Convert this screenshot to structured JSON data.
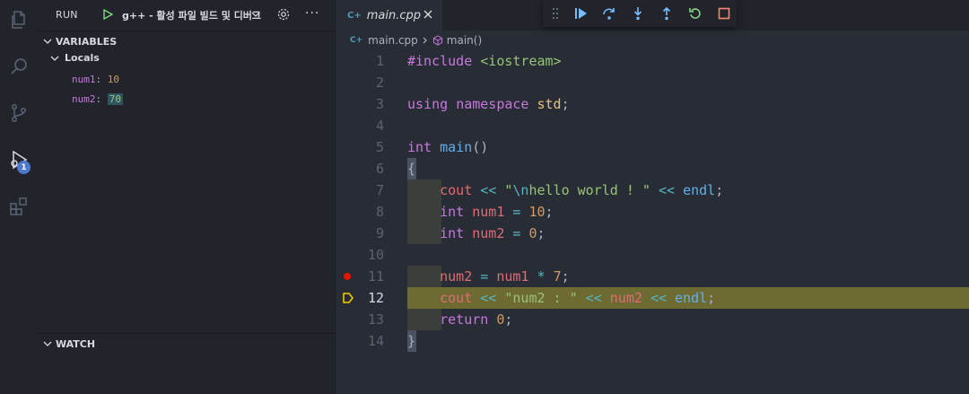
{
  "sidebar": {
    "title": "RUN",
    "config": "g++ - 활성 파일 빌드 및 디버그",
    "more": "···",
    "variables_title": "VARIABLES",
    "locals_title": "Locals",
    "vars": [
      {
        "name": "num1",
        "value": "10"
      },
      {
        "name": "num2",
        "value": "70"
      }
    ],
    "watch_title": "WATCH"
  },
  "activity": {
    "debug_badge": "1"
  },
  "tab": {
    "icon": "C+",
    "name": "main.cpp"
  },
  "breadcrumb": {
    "icon": "C+",
    "file": "main.cpp",
    "symbol": "main()"
  },
  "code": {
    "line_numbers": [
      "1",
      "2",
      "3",
      "4",
      "5",
      "6",
      "7",
      "8",
      "9",
      "10",
      "11",
      "12",
      "13",
      "14"
    ],
    "l1": {
      "directive": "#include",
      "header": "<iostream>"
    },
    "l3": {
      "using": "using",
      "namespace": "namespace",
      "std": "std",
      "semi": ";"
    },
    "l5": {
      "type": "int",
      "func": "main",
      "parens": "()"
    },
    "l6": {
      "brace": "{"
    },
    "l7": {
      "cout": "cout",
      "op1": "<<",
      "str1": "\"",
      "esc": "\\n",
      "str2": "hello world ! \"",
      "op2": "<<",
      "endl": "endl",
      "semi": ";"
    },
    "l8": {
      "type": "int",
      "var": "num1",
      "eq": "=",
      "num": "10",
      "semi": ";"
    },
    "l9": {
      "type": "int",
      "var": "num2",
      "eq": "=",
      "num": "0",
      "semi": ";"
    },
    "l11": {
      "var": "num2",
      "eq": "=",
      "var2": "num1",
      "mul": "*",
      "num": "7",
      "semi": ";"
    },
    "l12": {
      "cout": "cout",
      "op1": "<<",
      "str": "\"num2 : \"",
      "op2": "<<",
      "var": "num2",
      "op3": "<<",
      "endl": "endl",
      "semi": ";"
    },
    "l13": {
      "ret": "return",
      "num": "0",
      "semi": ";"
    },
    "l14": {
      "brace": "}"
    }
  },
  "colors": {
    "accent": "#4d78cc",
    "current_line": "#6d6a32",
    "breakpoint": "#e51400"
  }
}
